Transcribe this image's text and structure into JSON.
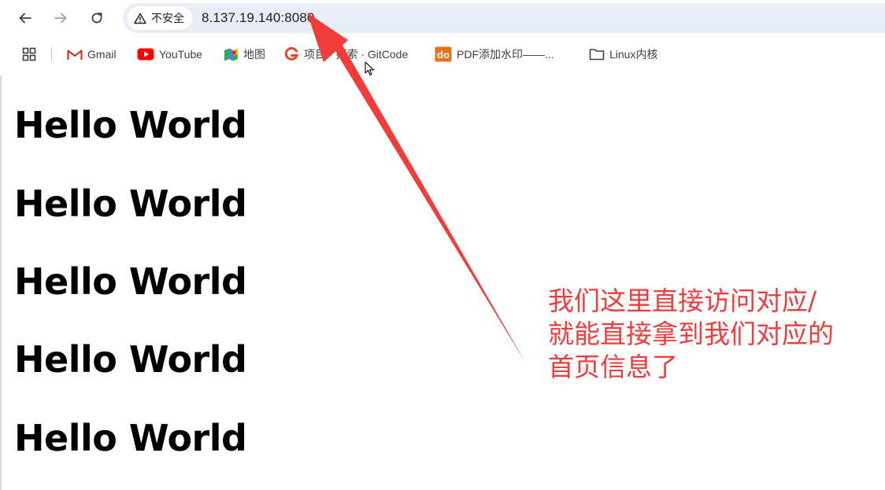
{
  "browser": {
    "security_label": "不安全",
    "url": "8.137.19.140:8080"
  },
  "bookmarks": [
    {
      "label": "Gmail",
      "icon": "gmail-icon"
    },
    {
      "label": "YouTube",
      "icon": "youtube-icon"
    },
    {
      "label": "地图",
      "icon": "maps-icon"
    },
    {
      "label": "项目 · 探索 · GitCode",
      "icon": "gitcode-icon"
    },
    {
      "label": "PDF添加水印——...",
      "icon": "do-icon"
    },
    {
      "label": "Linux内核",
      "icon": "folder-icon"
    }
  ],
  "page": {
    "headings": [
      "Hello World",
      "Hello World",
      "Hello World",
      "Hello World",
      "Hello World"
    ]
  },
  "annotation": {
    "lines": [
      "我们这里直接访问对应/",
      "就能直接拿到我们对应的",
      "首页信息了"
    ],
    "color": "#f23b3b"
  },
  "colors": {
    "address_bar_bg": "#e9eef6",
    "annotation": "#f23b3b"
  }
}
